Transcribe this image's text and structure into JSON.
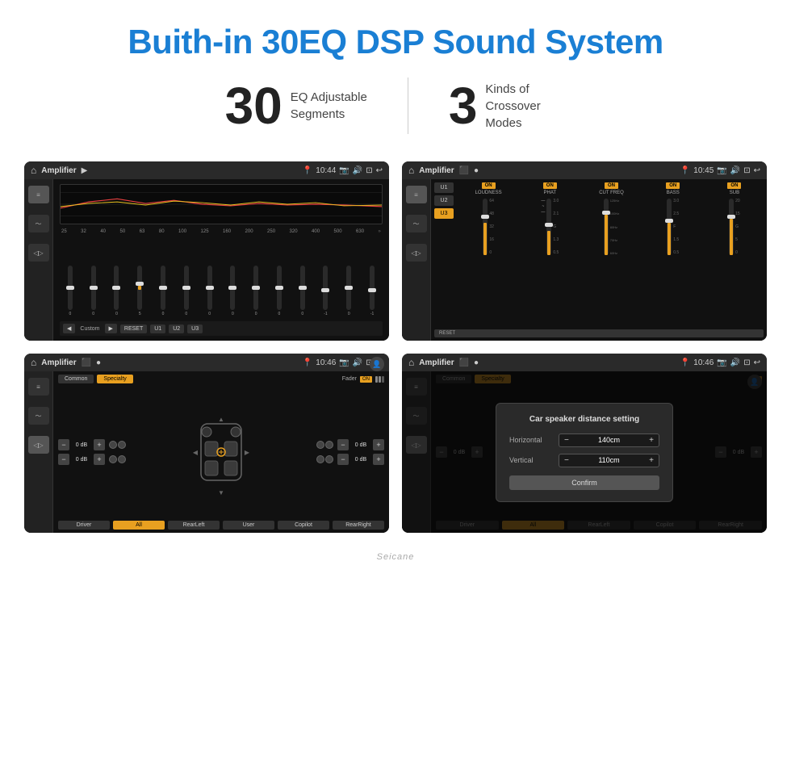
{
  "page": {
    "title": "Buith-in 30EQ DSP Sound System",
    "stats": [
      {
        "number": "30",
        "label": "EQ Adjustable\nSegments"
      },
      {
        "number": "3",
        "label": "Kinds of\nCrossover Modes"
      }
    ],
    "watermark": "Seicane"
  },
  "screens": {
    "eq1": {
      "topbar": {
        "title": "Amplifier",
        "time": "10:44"
      },
      "freqs": [
        "25",
        "32",
        "40",
        "50",
        "63",
        "80",
        "100",
        "125",
        "160",
        "200",
        "250",
        "320",
        "400",
        "500",
        "630"
      ],
      "values": [
        "0",
        "0",
        "0",
        "0",
        "5",
        "0",
        "0",
        "0",
        "0",
        "0",
        "0",
        "0",
        "0",
        "-1",
        "0",
        "-1"
      ],
      "bottom_buttons": [
        "Custom",
        "RESET",
        "U1",
        "U2",
        "U3"
      ]
    },
    "eq2": {
      "topbar": {
        "title": "Amplifier",
        "time": "10:45"
      },
      "presets": [
        "U1",
        "U2",
        "U3"
      ],
      "active_preset": "U3",
      "channels": [
        {
          "name": "LOUDNESS",
          "on": true
        },
        {
          "name": "PHAT",
          "on": true
        },
        {
          "name": "CUT FREQ",
          "on": true
        },
        {
          "name": "BASS",
          "on": true
        },
        {
          "name": "SUB",
          "on": true
        }
      ],
      "reset_label": "RESET"
    },
    "speaker1": {
      "topbar": {
        "title": "Amplifier",
        "time": "10:46"
      },
      "top_buttons": [
        "Common",
        "Specialty"
      ],
      "active_top": "Specialty",
      "fader_label": "Fader",
      "fader_on": true,
      "vol_left_top": "0 dB",
      "vol_left_bottom": "0 dB",
      "vol_right_top": "0 dB",
      "vol_right_bottom": "0 dB",
      "bottom_buttons": [
        "Driver",
        "RearLeft",
        "All",
        "User",
        "Copilot",
        "RearRight"
      ]
    },
    "speaker2": {
      "topbar": {
        "title": "Amplifier",
        "time": "10:46"
      },
      "top_buttons": [
        "Common",
        "Specialty"
      ],
      "active_top": "Specialty",
      "dialog": {
        "title": "Car speaker distance setting",
        "rows": [
          {
            "label": "Horizontal",
            "value": "140cm"
          },
          {
            "label": "Vertical",
            "value": "110cm"
          }
        ],
        "confirm_label": "Confirm"
      },
      "vol_left_top": "0 dB",
      "vol_right_top": "0 dB",
      "bottom_buttons": [
        "Driver",
        "RearLeft",
        "All",
        "User",
        "Copilot",
        "RearRight"
      ]
    }
  }
}
